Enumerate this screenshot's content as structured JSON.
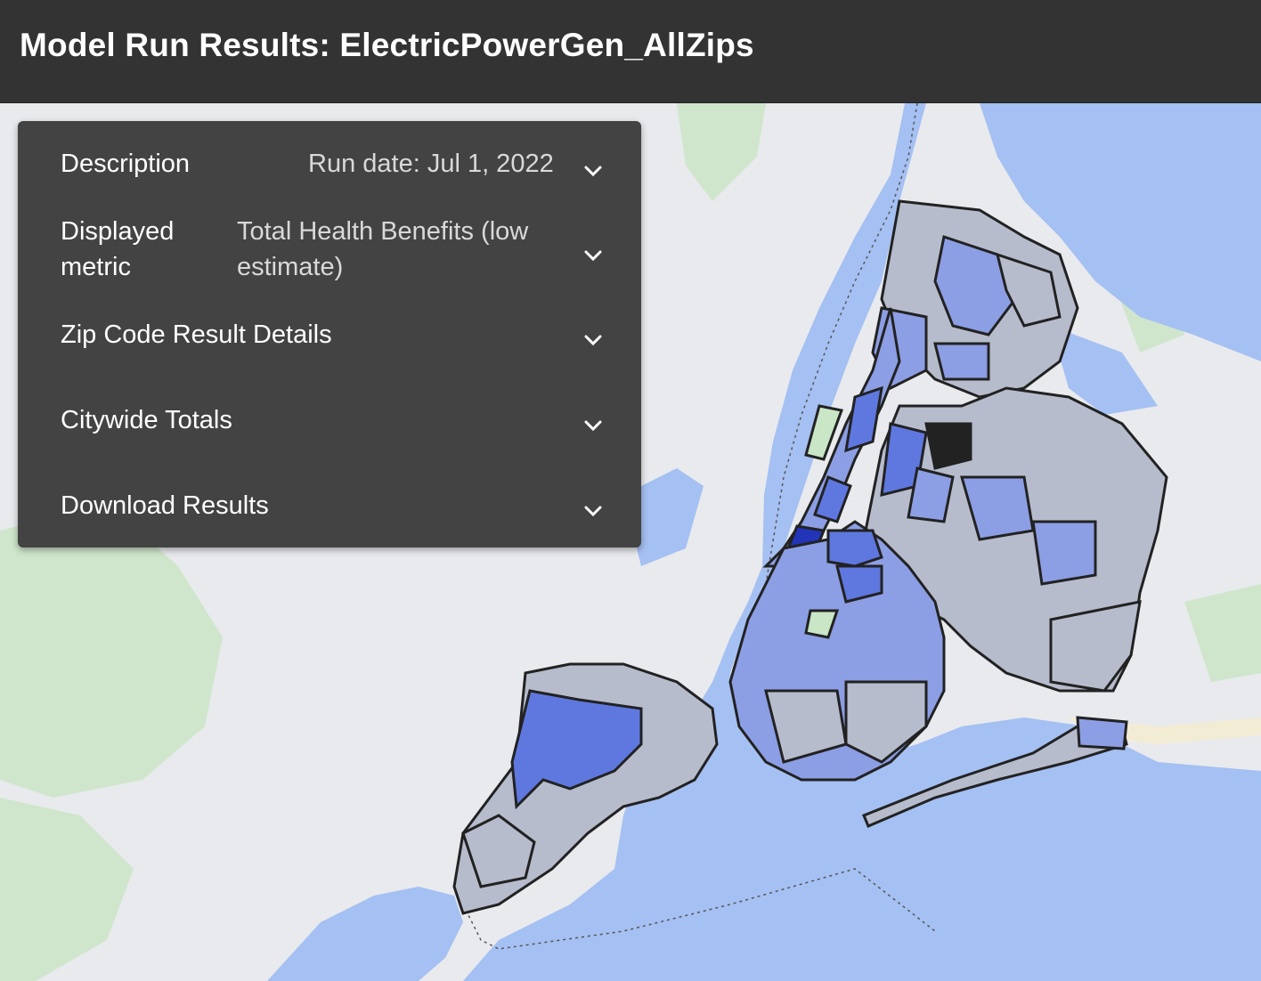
{
  "header": {
    "title": "Model Run Results: ElectricPowerGen_AllZips"
  },
  "panel": {
    "rows": [
      {
        "label": "Description",
        "value": "Run date: Jul 1, 2022",
        "icon": "chevron-down-icon"
      },
      {
        "label_line1": "Displayed",
        "label_line2": "metric",
        "value_line1": "Total Health Benefits (low",
        "value_line2": "estimate)",
        "icon": "chevron-down-icon"
      },
      {
        "label": "Zip Code Result Details",
        "icon": "chevron-down-icon"
      },
      {
        "label": "Citywide Totals",
        "icon": "chevron-down-icon"
      },
      {
        "label": "Download Results",
        "icon": "chevron-down-icon"
      }
    ]
  },
  "map": {
    "colors": {
      "water": "#a5c0f2",
      "land": "#e8eaed",
      "park": "#c9e6c7",
      "zip_low": "#b7bccd",
      "zip_mid": "#8c9ee4",
      "zip_high": "#5f78e0",
      "zip_max": "#2234b8",
      "zip_outline": "#222222"
    }
  }
}
